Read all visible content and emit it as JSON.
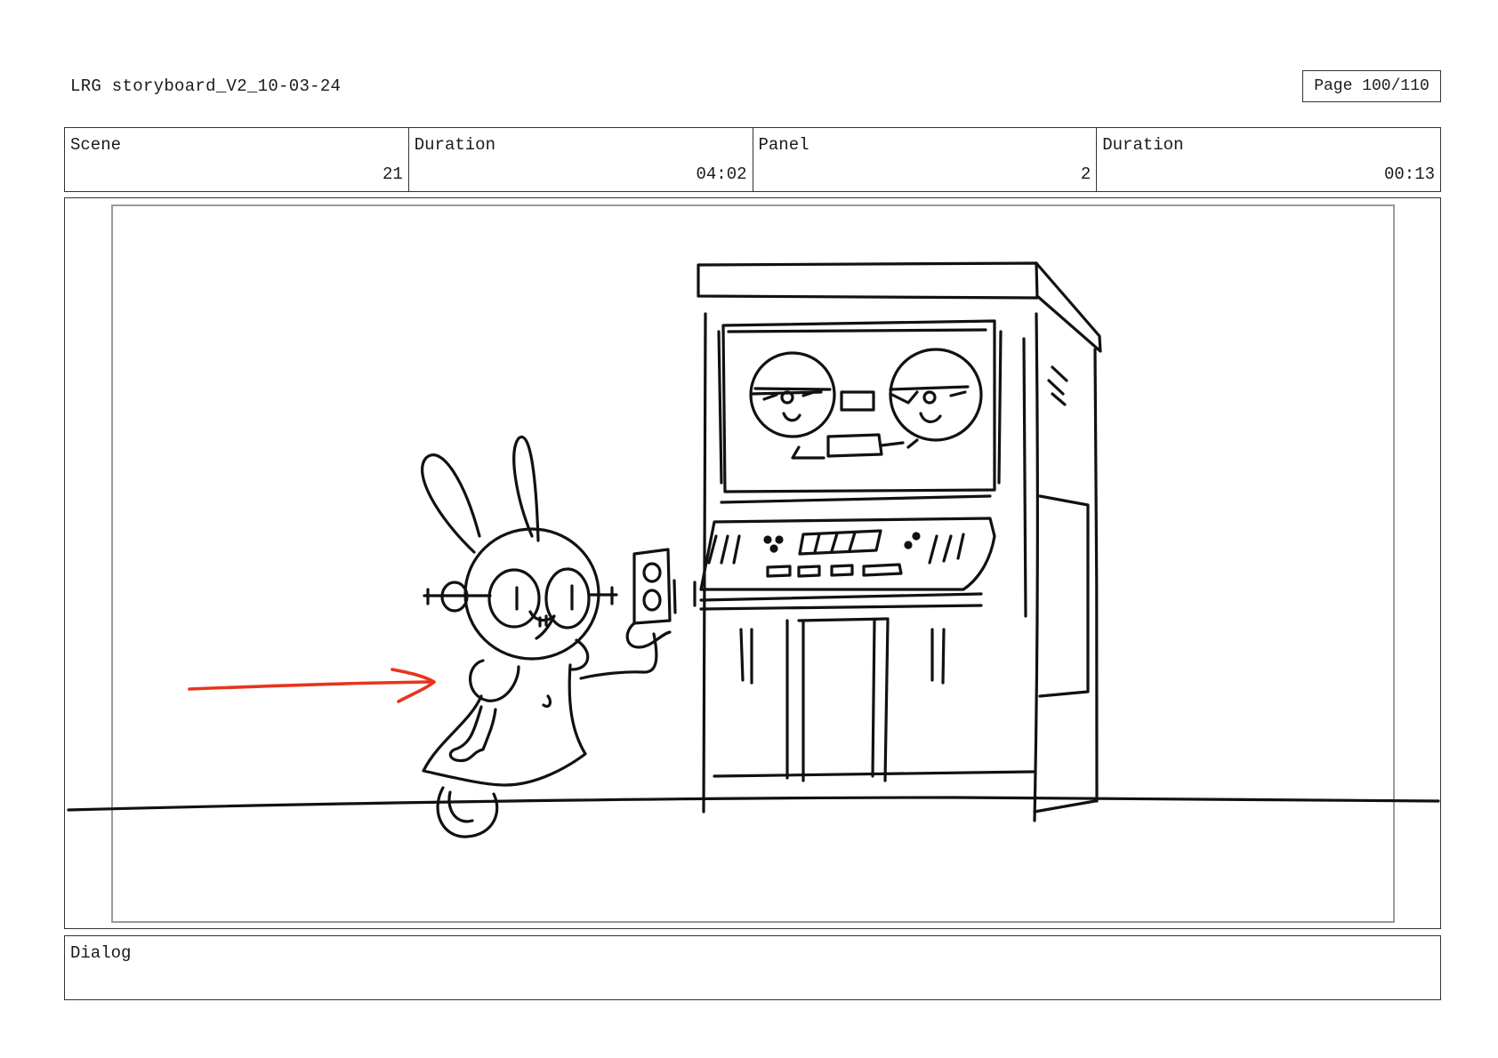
{
  "header": {
    "document_title": "LRG storyboard_V2_10-03-24",
    "page_indicator": "Page 100/110"
  },
  "info": {
    "scene_label": "Scene",
    "scene_value": "21",
    "scene_duration_label": "Duration",
    "scene_duration_value": "04:02",
    "panel_label": "Panel",
    "panel_value": "2",
    "panel_duration_label": "Duration",
    "panel_duration_value": "00:13"
  },
  "dialog": {
    "label": "Dialog",
    "text": ""
  },
  "colors": {
    "ink": "#111111",
    "arrow": "#e8341c",
    "frame_border": "#333333",
    "safe_area": "#9a9a9a"
  }
}
